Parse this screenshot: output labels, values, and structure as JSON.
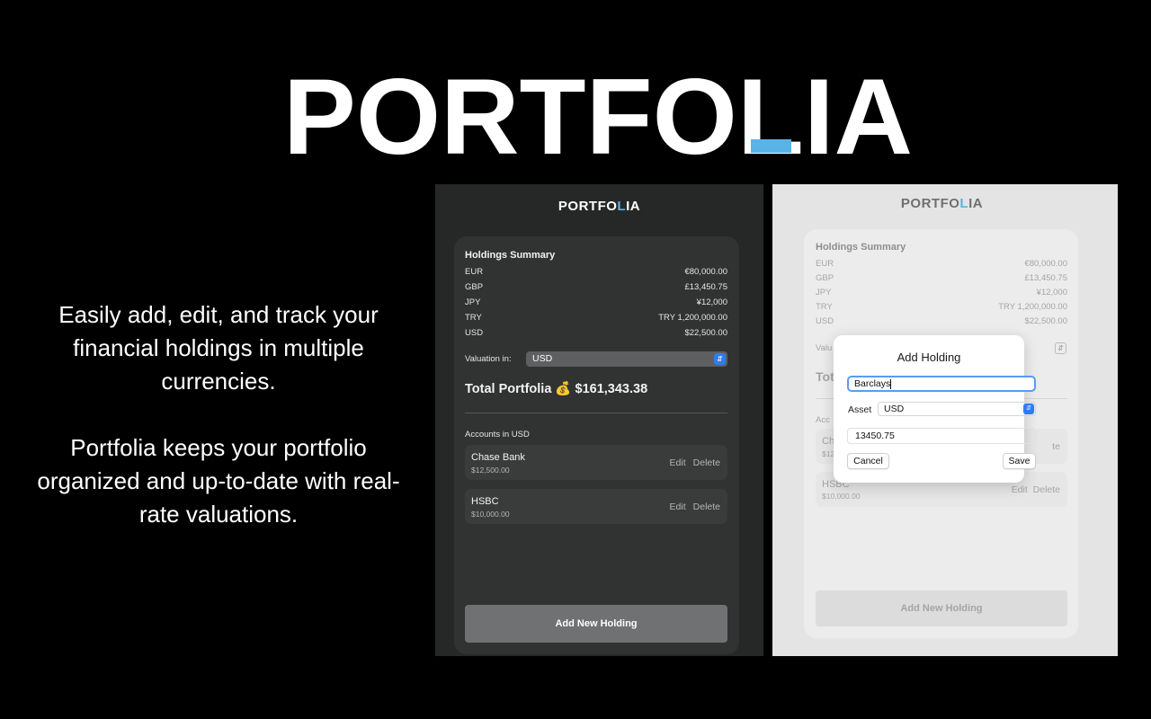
{
  "brand": {
    "logo_main": "PORTF",
    "logo_o": "O",
    "logo_tail": "LIA",
    "accent_color": "#5ab3e6"
  },
  "promo": {
    "paragraph1": "Easily add, edit, and track your financial holdings in multiple currencies.",
    "paragraph2": "Portfolia keeps your portfolio organized and up-to-date with real-rate valuations."
  },
  "app": {
    "logo_prefix": "PORTF",
    "logo_o": "O",
    "logo_l": "L",
    "logo_suffix": "IA",
    "holdings_title": "Holdings Summary",
    "holdings": [
      {
        "currency": "EUR",
        "amount": "€80,000.00"
      },
      {
        "currency": "GBP",
        "amount": "£13,450.75"
      },
      {
        "currency": "JPY",
        "amount": "¥12,000"
      },
      {
        "currency": "TRY",
        "amount": "TRY 1,200,000.00"
      },
      {
        "currency": "USD",
        "amount": "$22,500.00"
      }
    ],
    "valuation_label": "Valuation in:",
    "valuation_value": "USD",
    "total_label": "Total Portfolia 💰 $161,343.38",
    "accounts_title": "Accounts in USD",
    "accounts": [
      {
        "name": "Chase Bank",
        "amount": "$12,500.00"
      },
      {
        "name": "HSBC",
        "amount": "$10,000.00"
      }
    ],
    "edit_label": "Edit",
    "delete_label": "Delete",
    "add_button": "Add New Holding"
  },
  "dimmed": {
    "valuation_label_partial": "Valu",
    "total_partial": "Tot",
    "accounts_partial": "Acc",
    "acc1_partial": "Ch",
    "acc1_amt_partial": "$12",
    "acc1_edit_partial": "te",
    "acc2_name": "HSBC",
    "acc2_amt": "$10,000.00"
  },
  "dialog": {
    "title": "Add Holding",
    "name_value": "Barclays",
    "asset_label": "Asset",
    "asset_value": "USD",
    "amount_value": "13450.75",
    "cancel_label": "Cancel",
    "save_label": "Save"
  }
}
